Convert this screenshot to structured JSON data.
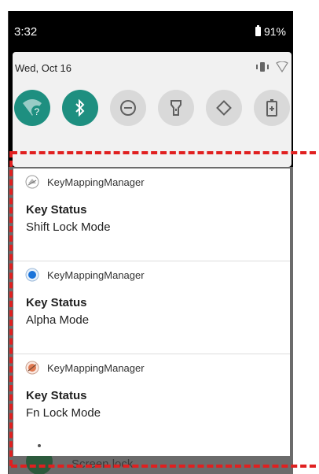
{
  "status_bar": {
    "time": "3:32",
    "battery": "91%"
  },
  "quick_settings": {
    "date": "Wed, Oct 16",
    "tiles": [
      {
        "icon": "wifi-unknown-icon",
        "active": true
      },
      {
        "icon": "bluetooth-icon",
        "active": true
      },
      {
        "icon": "do-not-disturb-icon",
        "active": false
      },
      {
        "icon": "flashlight-icon",
        "active": false
      },
      {
        "icon": "auto-rotate-icon",
        "active": false
      },
      {
        "icon": "battery-saver-icon",
        "active": false
      }
    ]
  },
  "notifications": [
    {
      "app": "KeyMappingManager",
      "title": "Key Status",
      "body": "Shift Lock Mode",
      "icon": "shift-key-app-icon"
    },
    {
      "app": "KeyMappingManager",
      "title": "Key Status",
      "body": "Alpha Mode",
      "icon": "alpha-app-icon"
    },
    {
      "app": "KeyMappingManager",
      "title": "Key Status",
      "body": "Fn Lock Mode",
      "icon": "fn-lock-app-icon"
    }
  ],
  "background_item": {
    "label": "Screen lock"
  },
  "colors": {
    "accent": "#1e8f80",
    "annotation": "#e02020"
  }
}
